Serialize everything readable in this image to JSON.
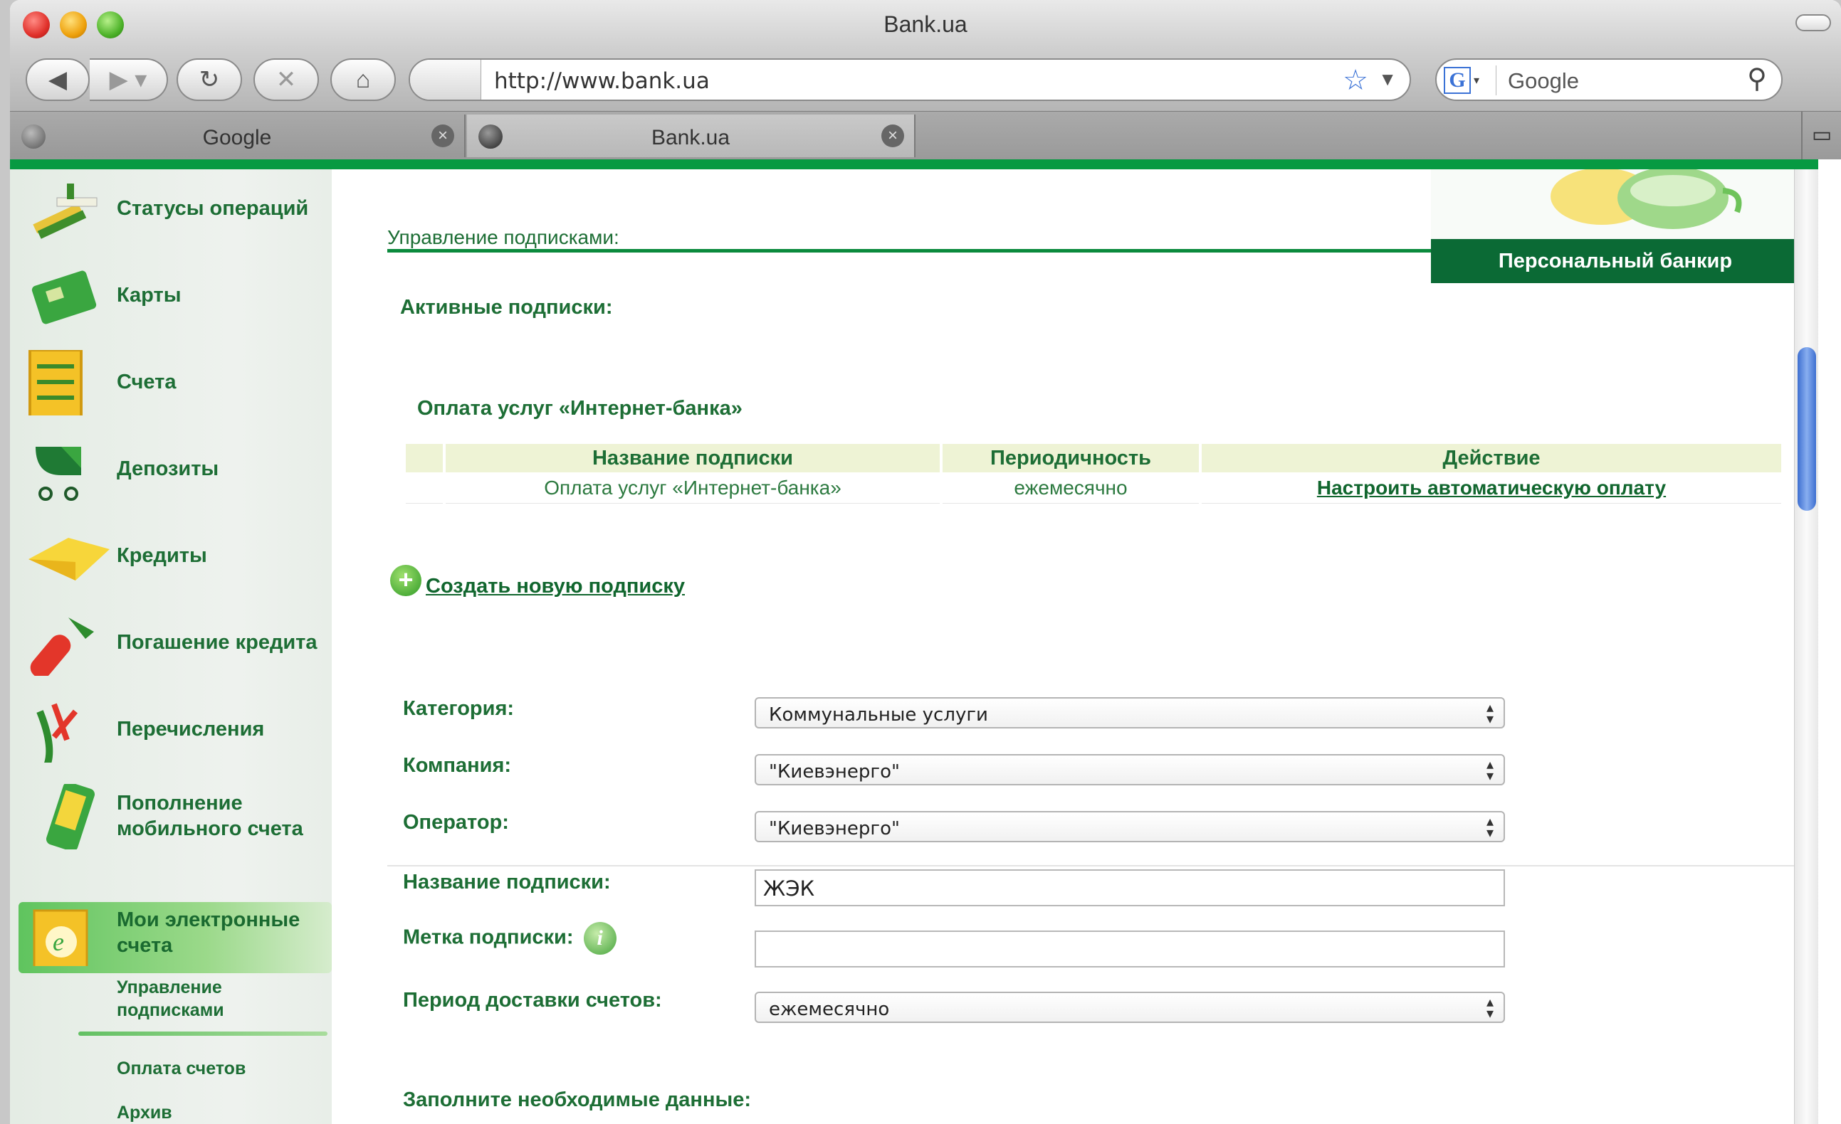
{
  "window": {
    "title": "Bank.ua"
  },
  "toolbar": {
    "url": "http://www.bank.ua",
    "search_placeholder": "Google"
  },
  "tabs": [
    {
      "label": "Google",
      "active": false
    },
    {
      "label": "Bank.ua",
      "active": true
    }
  ],
  "brand": {
    "green": "#079a42",
    "dark_green": "#0b6a35",
    "text_green": "#1d6e35"
  },
  "sidebar": {
    "items": [
      {
        "label": "Статусы операций",
        "icon": "operations-status-icon"
      },
      {
        "label": "Карты",
        "icon": "card-icon"
      },
      {
        "label": "Счета",
        "icon": "abacus-icon"
      },
      {
        "label": "Депозиты",
        "icon": "stroller-icon"
      },
      {
        "label": "Кредиты",
        "icon": "paper-boat-icon"
      },
      {
        "label": "Погашение кредита",
        "icon": "extinguisher-icon"
      },
      {
        "label": "Перечисления",
        "icon": "slingshot-icon"
      },
      {
        "label": "Пополнение мобильного счета",
        "icon": "mobile-phone-icon"
      },
      {
        "label": "Мои электронные счета",
        "icon": "e-box-icon",
        "selected": true
      }
    ],
    "sub_items": [
      {
        "label": "Управление подписками",
        "selected": true
      },
      {
        "label": "Оплата счетов"
      },
      {
        "label": "Архив"
      }
    ]
  },
  "banner": {
    "label": "Персональный банкир"
  },
  "main": {
    "page_title": "Управление подписками:",
    "active_heading": "Активные подписки:",
    "group_heading": "Оплата услуг «Интернет-банка»",
    "table": {
      "headers": [
        "",
        "Название подписки",
        "Периодичность",
        "Действие"
      ],
      "rows": [
        {
          "name": "Оплата услуг «Интернет-банка»",
          "period": "ежемесячно",
          "action": "Настроить автоматическую оплату"
        }
      ]
    },
    "create_link": "Создать новую подписку"
  },
  "form": {
    "category": {
      "label": "Категория:",
      "value": "Коммунальные услуги"
    },
    "company": {
      "label": "Компания:",
      "value": "\"Киевэнерго\""
    },
    "operator": {
      "label": "Оператор:",
      "value": "\"Киевэнерго\""
    },
    "sub_name": {
      "label": "Название подписки:",
      "value": "ЖЭК"
    },
    "sub_tag": {
      "label": "Метка подписки:",
      "value": ""
    },
    "delivery": {
      "label": "Период доставки счетов:",
      "value": "ежемесячно"
    },
    "fill_heading": "Заполните необходимые данные:"
  }
}
